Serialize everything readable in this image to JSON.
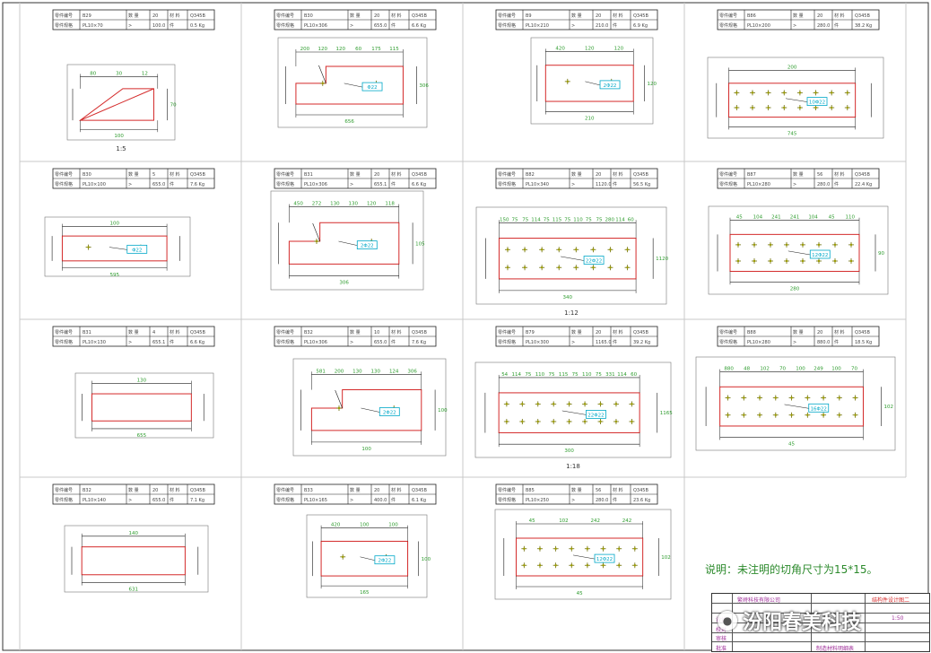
{
  "note": "说明：未注明的切角尺寸为15*15。",
  "watermark": "汾阳春美科技",
  "titleblock": {
    "project": "繁峙科技有限公司",
    "sheet": "制造材料明细表",
    "drawing_no": "结构件设计图二",
    "labels": [
      "设计",
      "校对",
      "审核",
      "批准"
    ],
    "scale": "1:50"
  },
  "colors": {
    "dim": "#1a1a1a",
    "part": "#d42a2a",
    "dimtext": "#2e9c2e",
    "callout": "#00a8c8",
    "frame": "#c8c8c8"
  },
  "panels": [
    {
      "header": {
        "part": "B29",
        "label1": "零件编号",
        "label2": "零件规格",
        "spec": "PL10×70",
        "q_label": "数 量",
        "qty": "20",
        "unit": "件",
        "mat_label": "材 料",
        "mat": "Q345B",
        "len": "100.0",
        "wt": "0.5 Kg"
      },
      "dims": [
        "80",
        "30",
        "12",
        "70",
        "100"
      ],
      "scale": "1:5",
      "callout": "",
      "shape": "triangle"
    },
    {
      "header": {
        "part": "B30",
        "label1": "零件编号",
        "label2": "零件规格",
        "spec": "PL10×306",
        "q_label": "数 量",
        "qty": "20",
        "unit": "件",
        "mat_label": "材 料",
        "mat": "Q345B",
        "len": "655.0",
        "wt": "6.6 Kg"
      },
      "dims": [
        "200",
        "120",
        "120",
        "60",
        "175",
        "115",
        "306",
        "656"
      ],
      "scale": "",
      "callout": "Φ22",
      "shape": "notched"
    },
    {
      "header": {
        "part": "B9",
        "label1": "零件编号",
        "label2": "零件规格",
        "spec": "PL10×210",
        "q_label": "数 量",
        "qty": "20",
        "unit": "件",
        "mat_label": "材 料",
        "mat": "Q345B",
        "len": "210.0",
        "wt": "6.9 Kg"
      },
      "dims": [
        "420",
        "120",
        "120",
        "120",
        "210"
      ],
      "scale": "",
      "callout": "2Φ22",
      "shape": "rect"
    },
    {
      "header": {
        "part": "B86",
        "label1": "零件编号",
        "label2": "零件规格",
        "spec": "PL10×200",
        "q_label": "数 量",
        "qty": "20",
        "unit": "件",
        "mat_label": "材 料",
        "mat": "Q345B",
        "len": "280.0",
        "wt": "38.2 Kg"
      },
      "dims": [
        "200",
        "745"
      ],
      "scale": "",
      "callout": "10Φ22",
      "shape": "rect-holes"
    },
    {
      "header": {
        "part": "B30",
        "label1": "零件编号",
        "label2": "零件规格",
        "spec": "PL10×100",
        "q_label": "数 量",
        "qty": "5",
        "unit": "件",
        "mat_label": "材 料",
        "mat": "Q345B",
        "len": "655.0",
        "wt": "7.6 Kg"
      },
      "dims": [
        "100",
        "595"
      ],
      "scale": "",
      "callout": "Φ22",
      "shape": "rect"
    },
    {
      "header": {
        "part": "B31",
        "label1": "零件编号",
        "label2": "零件规格",
        "spec": "PL10×306",
        "q_label": "数 量",
        "qty": "20",
        "unit": "件",
        "mat_label": "材 料",
        "mat": "Q345B",
        "len": "655.1",
        "wt": "6.6 Kg"
      },
      "dims": [
        "450",
        "272",
        "130",
        "130",
        "120",
        "118",
        "105",
        "306"
      ],
      "scale": "",
      "callout": "2Φ22",
      "shape": "notched"
    },
    {
      "header": {
        "part": "B82",
        "label1": "零件编号",
        "label2": "零件规格",
        "spec": "PL10×340",
        "q_label": "数 量",
        "qty": "20",
        "unit": "件",
        "mat_label": "材 料",
        "mat": "Q345B",
        "len": "1120.0",
        "wt": "56.5 Kg"
      },
      "dims": [
        "150",
        "75",
        "75",
        "114",
        "75",
        "115",
        "75",
        "110",
        "75",
        "75",
        "280",
        "114",
        "60",
        "1120",
        "340"
      ],
      "scale": "1:12",
      "callout": "22Φ22",
      "shape": "rect-holes"
    },
    {
      "header": {
        "part": "B87",
        "label1": "零件编号",
        "label2": "零件规格",
        "spec": "PL10×280",
        "q_label": "数 量",
        "qty": "56",
        "unit": "件",
        "mat_label": "材 料",
        "mat": "Q345B",
        "len": "280.0",
        "wt": "22.4 Kg"
      },
      "dims": [
        "45",
        "104",
        "241",
        "241",
        "104",
        "45",
        "110",
        "90",
        "280"
      ],
      "scale": "",
      "callout": "12Φ22",
      "shape": "rect-holes"
    },
    {
      "header": {
        "part": "B31",
        "label1": "零件编号",
        "label2": "零件规格",
        "spec": "PL10×130",
        "q_label": "数 量",
        "qty": "4",
        "unit": "件",
        "mat_label": "材 料",
        "mat": "Q345B",
        "len": "655.1",
        "wt": "6.6 Kg"
      },
      "dims": [
        "130",
        "655"
      ],
      "scale": "",
      "callout": "",
      "shape": "rect"
    },
    {
      "header": {
        "part": "B32",
        "label1": "零件编号",
        "label2": "零件规格",
        "spec": "PL10×306",
        "q_label": "数 量",
        "qty": "10",
        "unit": "件",
        "mat_label": "材 料",
        "mat": "Q345B",
        "len": "655.0",
        "wt": "7.6 Kg"
      },
      "dims": [
        "581",
        "200",
        "130",
        "130",
        "124",
        "306",
        "100",
        "100"
      ],
      "scale": "",
      "callout": "2Φ22",
      "shape": "notched"
    },
    {
      "header": {
        "part": "B79",
        "label1": "零件编号",
        "label2": "零件规格",
        "spec": "PL10×300",
        "q_label": "数 量",
        "qty": "20",
        "unit": "件",
        "mat_label": "材 料",
        "mat": "Q345B",
        "len": "1165.0",
        "wt": "39.2 Kg"
      },
      "dims": [
        "54",
        "114",
        "75",
        "110",
        "75",
        "115",
        "75",
        "110",
        "75",
        "331",
        "114",
        "60",
        "1165",
        "300"
      ],
      "scale": "1:18",
      "callout": "22Φ22",
      "shape": "rect-holes"
    },
    {
      "header": {
        "part": "B88",
        "label1": "零件编号",
        "label2": "零件规格",
        "spec": "PL10×280",
        "q_label": "数 量",
        "qty": "20",
        "unit": "件",
        "mat_label": "材 料",
        "mat": "Q345B",
        "len": "880.0",
        "wt": "18.5 Kg"
      },
      "dims": [
        "880",
        "48",
        "102",
        "70",
        "100",
        "249",
        "100",
        "70",
        "102",
        "45"
      ],
      "scale": "",
      "callout": "16Φ22",
      "shape": "rect-holes"
    },
    {
      "header": {
        "part": "B32",
        "label1": "零件编号",
        "label2": "零件规格",
        "spec": "PL10×140",
        "q_label": "数 量",
        "qty": "20",
        "unit": "件",
        "mat_label": "材 料",
        "mat": "Q345B",
        "len": "655.0",
        "wt": "7.1 Kg"
      },
      "dims": [
        "140",
        "631"
      ],
      "scale": "",
      "callout": "",
      "shape": "rect"
    },
    {
      "header": {
        "part": "B33",
        "label1": "零件编号",
        "label2": "零件规格",
        "spec": "PL10×165",
        "q_label": "数 量",
        "qty": "20",
        "unit": "件",
        "mat_label": "材 料",
        "mat": "Q345B",
        "len": "400.0",
        "wt": "6.1 Kg"
      },
      "dims": [
        "420",
        "100",
        "100",
        "100",
        "165"
      ],
      "scale": "",
      "callout": "2Φ22",
      "shape": "rect"
    },
    {
      "header": {
        "part": "B85",
        "label1": "零件编号",
        "label2": "零件规格",
        "spec": "PL10×250",
        "q_label": "数 量",
        "qty": "56",
        "unit": "件",
        "mat_label": "材 料",
        "mat": "Q345B",
        "len": "280.0",
        "wt": "23.6 Kg"
      },
      "dims": [
        "45",
        "102",
        "242",
        "242",
        "102",
        "45"
      ],
      "scale": "",
      "callout": "12Φ22",
      "shape": "rect-holes"
    }
  ]
}
